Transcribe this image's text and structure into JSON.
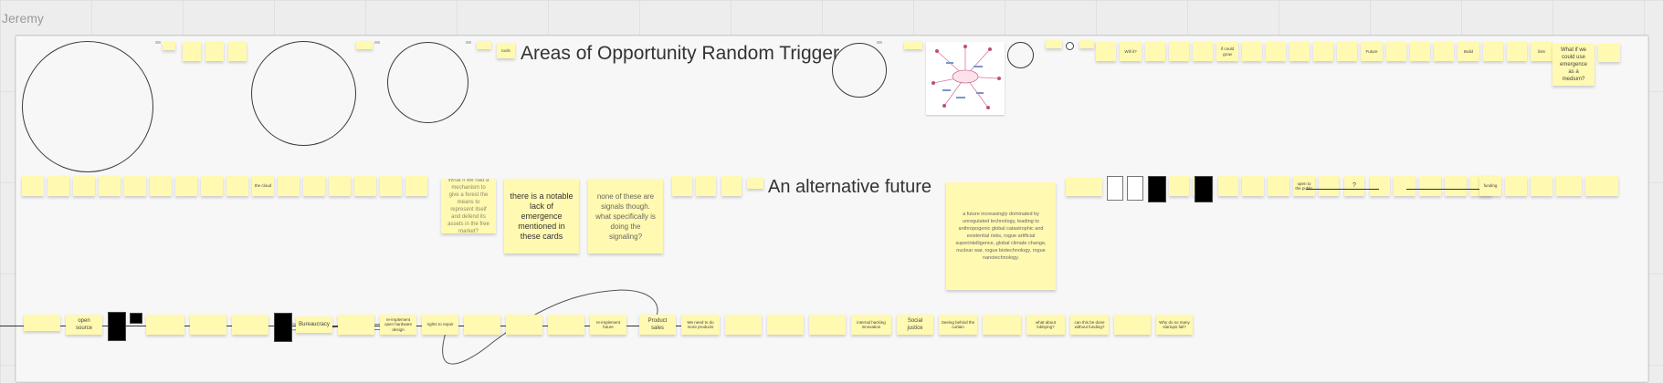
{
  "board": {
    "owner": "Jeremy"
  },
  "titles": {
    "opportunity": "Areas of Opportunity Random Trigger",
    "alt_future": "An alternative future"
  },
  "row1_notes": {
    "what_if_emergence": "What if we could use emergence as a medium?",
    "lists": "lists",
    "will_it": "Will it?",
    "future": "Future",
    "build": "Build",
    "if_could": "if could grow",
    "tools": "tools"
  },
  "row2_notes": {
    "mechanism": "What if we had a mechanism to give a forest the means to represent itself and defend its assets in the free market?",
    "lack_emergence": "there is a notable lack of emergence mentioned in these cards",
    "signals": "none of these are signals though. what specifically is doing the signaling?",
    "future_desc": "a future increasingly dominated by unregulated technology, leading to anthropogenic global catastrophic and existential risks, rogue artificial superintelligence, global climate change, nuclear war, rogue biotechnology, rogue nanotechnology.",
    "the_cloud": "the cloud",
    "open_to_public": "open to the public",
    "question": "?",
    "funding": "funding"
  },
  "row3_notes": {
    "open_source": "open source",
    "bureaucracy": "Bureaucracy",
    "rights_to_repair": "rights to repair",
    "product_sales": "Product sales",
    "social_justice": "Social justice",
    "reimplement_future": "re-implement future",
    "open_hardware": "re-implement open hardware design",
    "what_about_lobbying": "what about lobbying?",
    "can_this_be_done": "can this be done without funding?",
    "why_so_many": "Why do so many startups fail?",
    "seeing_behind": "Seeing behind the curtain",
    "internal_hacking": "internal hacking innovation",
    "we_need": "We need to do more products"
  }
}
